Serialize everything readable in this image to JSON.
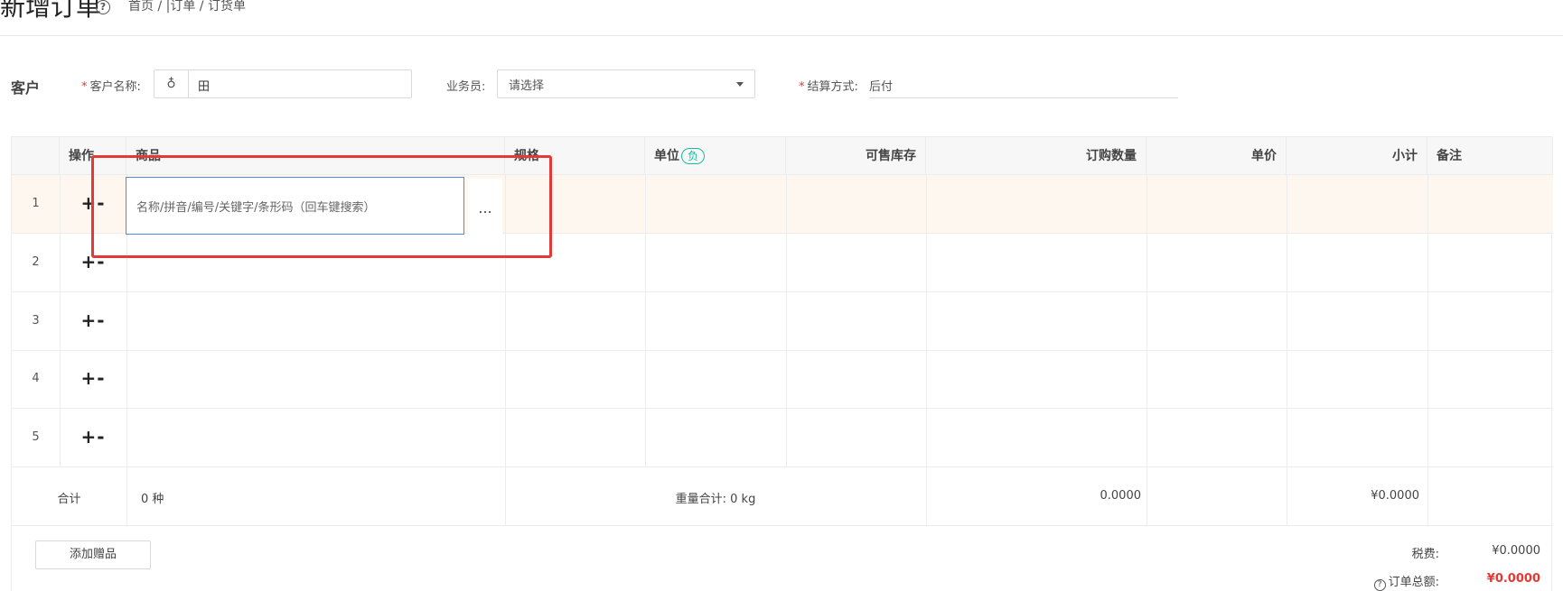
{
  "header": {
    "title": "新增订单",
    "breadcrumb": "首页 / |订单 / 订货单",
    "help_glyph": "?"
  },
  "customer": {
    "section_label": "客户",
    "name_label": "客户名称:",
    "name_value": "田",
    "salesperson_label": "业务员:",
    "salesperson_value": "请选择",
    "settlement_label": "结算方式:",
    "settlement_value": "后付"
  },
  "table": {
    "columns": [
      "操作",
      "商品",
      "规格",
      "单位",
      "可售库存",
      "订购数量",
      "单价",
      "小计",
      "备注"
    ],
    "unit_badge": "负",
    "rows": [
      {
        "num": "1",
        "ops": "+-"
      },
      {
        "num": "2",
        "ops": "+-"
      },
      {
        "num": "3",
        "ops": "+-"
      },
      {
        "num": "4",
        "ops": "+-"
      },
      {
        "num": "5",
        "ops": "+-"
      }
    ],
    "product_placeholder": "名称/拼音/编号/关键字/条形码（回车键搜索）",
    "more_button": "...",
    "summary": {
      "label": "合计",
      "kinds": "0 种",
      "weight": "重量合计: 0 kg",
      "quantity": "0.0000",
      "subtotal": "¥0.0000"
    }
  },
  "footer": {
    "add_gift_label": "添加赠品",
    "tax_label": "税费:",
    "tax_value": "¥0.0000",
    "total_label": "订单总额:",
    "total_value": "¥0.0000"
  },
  "colors": {
    "accent_red": "#e53935",
    "badge_teal": "#1abc9c",
    "focus_blue": "#4a90d9"
  }
}
